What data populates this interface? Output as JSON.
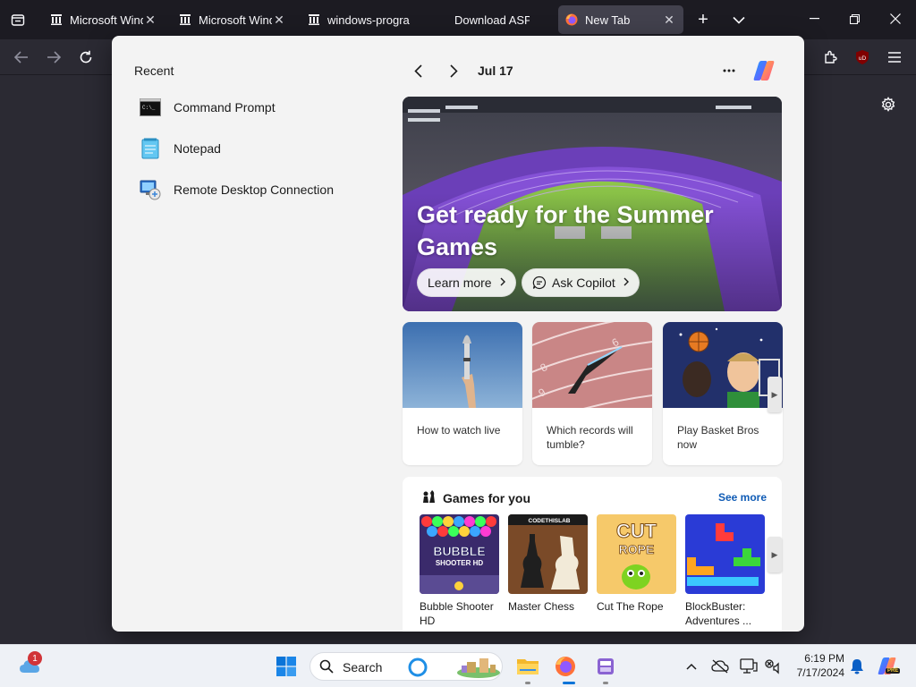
{
  "browser": {
    "tabs": [
      {
        "title": "Microsoft Windows",
        "active": false
      },
      {
        "title": "Microsoft Windows",
        "active": false
      },
      {
        "title": "windows-programs",
        "active": false
      },
      {
        "title": "Download ASP.NET",
        "active": false
      },
      {
        "title": "New Tab",
        "active": true
      }
    ],
    "extension_badge": "uD"
  },
  "widgets": {
    "recent": {
      "title": "Recent",
      "items": [
        {
          "label": "Command Prompt",
          "icon": "command-prompt-icon"
        },
        {
          "label": "Notepad",
          "icon": "notepad-icon"
        },
        {
          "label": "Remote Desktop Connection",
          "icon": "remote-desktop-icon"
        }
      ]
    },
    "feed": {
      "date": "Jul 17",
      "hero": {
        "title": "Get ready for the Summer Games",
        "learn_more": "Learn more",
        "ask_copilot": "Ask Copilot"
      },
      "cards": [
        {
          "label": "How to watch live"
        },
        {
          "label": "Which records will tumble?"
        },
        {
          "label": "Play Basket Bros now"
        }
      ],
      "games": {
        "title": "Games for you",
        "see_more": "See more",
        "items": [
          {
            "label": "Bubble Shooter HD",
            "art": "BUBBLE SHOOTER HD"
          },
          {
            "label": "Master Chess",
            "art": "CODETHISLAB"
          },
          {
            "label": "Cut The Rope",
            "art": "CUT the ROPE"
          },
          {
            "label": "BlockBuster: Adventures ..."
          }
        ]
      }
    }
  },
  "taskbar": {
    "weather_badge": "1",
    "search_label": "Search",
    "time": "6:19 PM",
    "date": "7/17/2024",
    "copilot_badge": "PRE"
  },
  "colors": {
    "chrome_dark": "#1c1b22",
    "toolbar": "#2b2a33",
    "widget_bg": "#f3f3f3",
    "link_blue": "#0f5bb5",
    "taskbar": "#eef1f6"
  }
}
